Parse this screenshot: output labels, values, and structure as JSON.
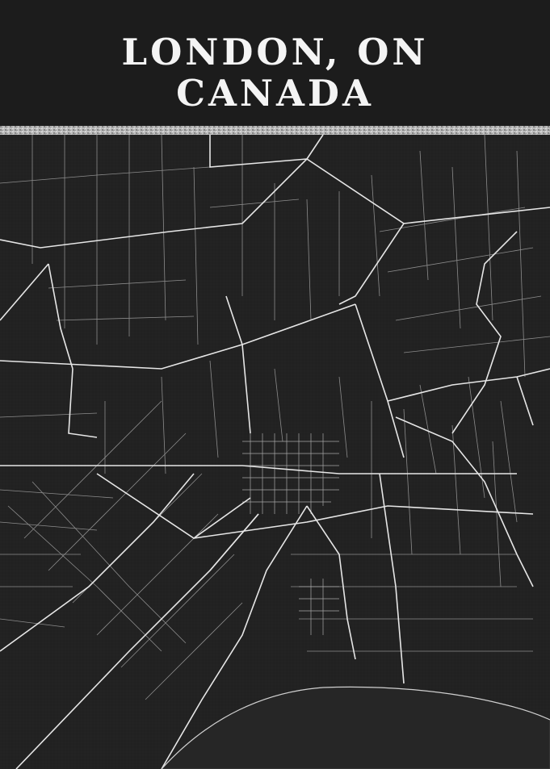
{
  "title": {
    "line1": "LONDON, ON",
    "line2": "CANADA"
  },
  "colors": {
    "background": "#1f1f1f",
    "header": "#1c1c1c",
    "roads": "#e6e6e6",
    "minor_roads": "#9a9a9a",
    "water": "#2a2a2a",
    "title_text": "#f4f4f4"
  },
  "map": {
    "style": "chalkboard street map",
    "features": [
      "major-roads",
      "minor-roads",
      "downtown-grid",
      "lake-shoreline"
    ]
  }
}
